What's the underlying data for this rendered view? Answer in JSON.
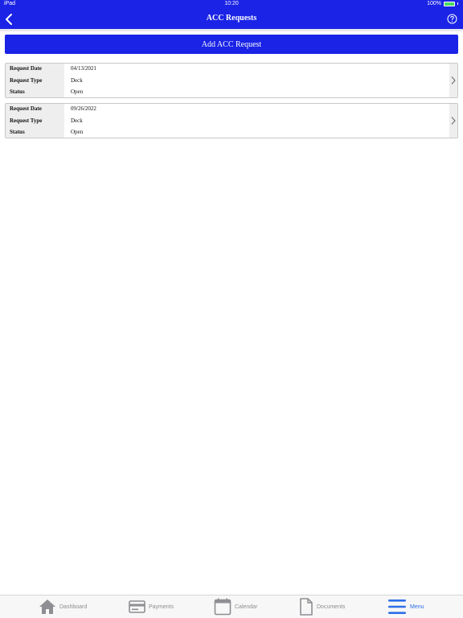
{
  "status_bar": {
    "carrier": "iPad",
    "time": "10:20",
    "battery": "100%"
  },
  "nav": {
    "title": "ACC Requests"
  },
  "add_button": {
    "label": "Add ACC Request"
  },
  "requests": [
    {
      "date_label": "Request Date",
      "date": "04/13/2021",
      "type_label": "Request Type",
      "type": "Deck",
      "status_label": "Status",
      "status": "Open"
    },
    {
      "date_label": "Request Date",
      "date": "09/26/2022",
      "type_label": "Request Type",
      "type": "Deck",
      "status_label": "Status",
      "status": "Open"
    }
  ],
  "tabs": [
    {
      "label": "Dashboard",
      "icon": "home-icon"
    },
    {
      "label": "Payments",
      "icon": "credit-card-icon"
    },
    {
      "label": "Calendar",
      "icon": "calendar-icon"
    },
    {
      "label": "Documents",
      "icon": "document-icon"
    },
    {
      "label": "Menu",
      "icon": "menu-icon",
      "active": true
    }
  ],
  "colors": {
    "brand": "#1a23e6",
    "tab_active": "#2d6fe8",
    "tab_inactive": "#8e8e93"
  }
}
